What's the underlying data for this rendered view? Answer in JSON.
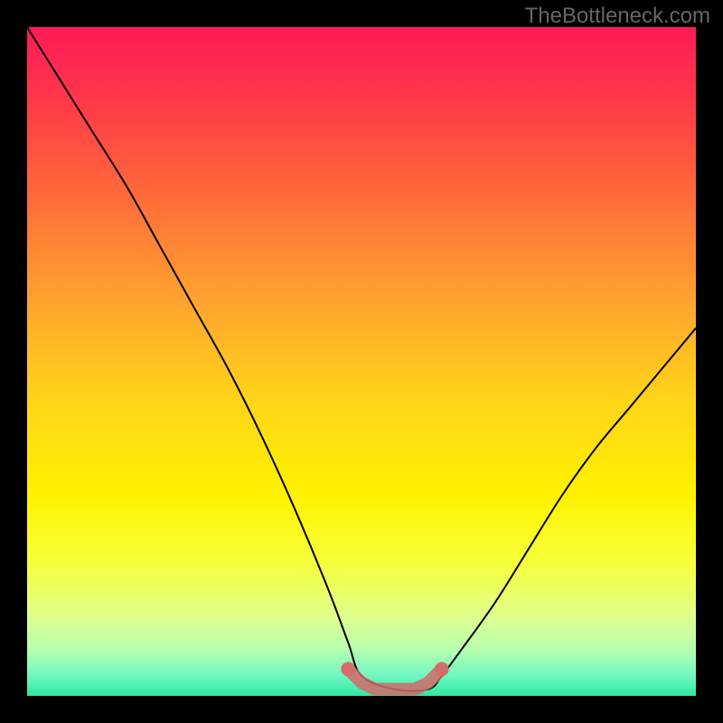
{
  "watermark": "TheBottleneck.com",
  "chart_data": {
    "type": "line",
    "title": "",
    "xlabel": "",
    "ylabel": "",
    "xlim": [
      0,
      100
    ],
    "ylim": [
      0,
      100
    ],
    "background": {
      "type": "vertical-gradient",
      "stops": [
        {
          "pos": 0.0,
          "color": "#ff1a58"
        },
        {
          "pos": 0.12,
          "color": "#ff3b48"
        },
        {
          "pos": 0.25,
          "color": "#ff6a3a"
        },
        {
          "pos": 0.4,
          "color": "#ffa030"
        },
        {
          "pos": 0.55,
          "color": "#ffd21a"
        },
        {
          "pos": 0.7,
          "color": "#fff200"
        },
        {
          "pos": 0.8,
          "color": "#f7ff3a"
        },
        {
          "pos": 0.88,
          "color": "#e0ff8a"
        },
        {
          "pos": 0.93,
          "color": "#b8ffb0"
        },
        {
          "pos": 0.97,
          "color": "#70f7c0"
        },
        {
          "pos": 1.0,
          "color": "#2ce8a0"
        }
      ]
    },
    "series": [
      {
        "name": "bottleneck-curve",
        "color": "#000000",
        "x": [
          0,
          5,
          10,
          15,
          20,
          25,
          30,
          35,
          40,
          45,
          48,
          50,
          55,
          60,
          62,
          65,
          70,
          75,
          80,
          85,
          90,
          95,
          100
        ],
        "y": [
          100,
          92,
          84,
          76,
          67,
          58,
          49,
          39,
          28,
          16,
          8,
          3,
          1,
          1,
          3,
          7,
          14,
          22,
          30,
          37,
          43,
          49,
          55
        ]
      },
      {
        "name": "optimal-zone-marker",
        "color": "#d36a6a",
        "style": "thick-dotted",
        "x": [
          48,
          50,
          52,
          54,
          56,
          58,
          60,
          62
        ],
        "y": [
          4,
          2,
          1,
          1,
          1,
          1,
          2,
          4
        ]
      }
    ]
  }
}
